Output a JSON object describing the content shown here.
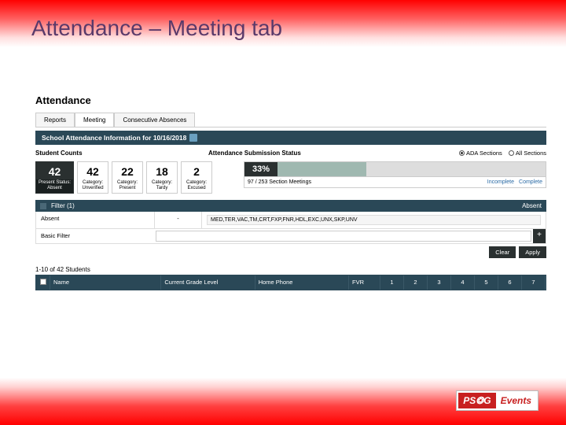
{
  "slide_title": "Attendance – Meeting tab",
  "app_title": "Attendance",
  "tabs": [
    "Reports",
    "Meeting",
    "Consecutive Absences"
  ],
  "panel_title": "School Attendance Information for 10/16/2018",
  "counts_label": "Student Counts",
  "counts": [
    {
      "value": "42",
      "top": "Present Status:",
      "bot": "Absent",
      "dark": true
    },
    {
      "value": "42",
      "top": "Category:",
      "bot": "Unverified"
    },
    {
      "value": "22",
      "top": "Category:",
      "bot": "Present"
    },
    {
      "value": "18",
      "top": "Category:",
      "bot": "Tardy"
    },
    {
      "value": "2",
      "top": "Category:",
      "bot": "Excused"
    }
  ],
  "submission_label": "Attendance Submission Status",
  "radios": {
    "ada": "ADA Sections",
    "all": "All Sections"
  },
  "progress": {
    "pct": "33%",
    "fill": 33,
    "sub": "97 / 253 Section Meetings",
    "incomplete": "Incomplete",
    "complete": "Complete"
  },
  "filter": {
    "title": "Filter (1)",
    "right": "Absent",
    "row_label": "Absent",
    "op": "-",
    "tags": "MED,TER,VAC,TM,CRT,FXP,FNR,HDL,EXC,UNX,SKP,UNV",
    "basic": "Basic Filter",
    "placeholder": ""
  },
  "buttons": {
    "clear": "Clear",
    "apply": "Apply"
  },
  "result_count": "1-10 of 42 Students",
  "columns": {
    "name": "Name",
    "grade": "Current Grade Level",
    "phone": "Home Phone",
    "fvr": "FVR"
  },
  "periods": [
    "1",
    "2",
    "3",
    "4",
    "5",
    "6",
    "7"
  ],
  "logo": {
    "left": "PS❂G",
    "right": "Events"
  }
}
